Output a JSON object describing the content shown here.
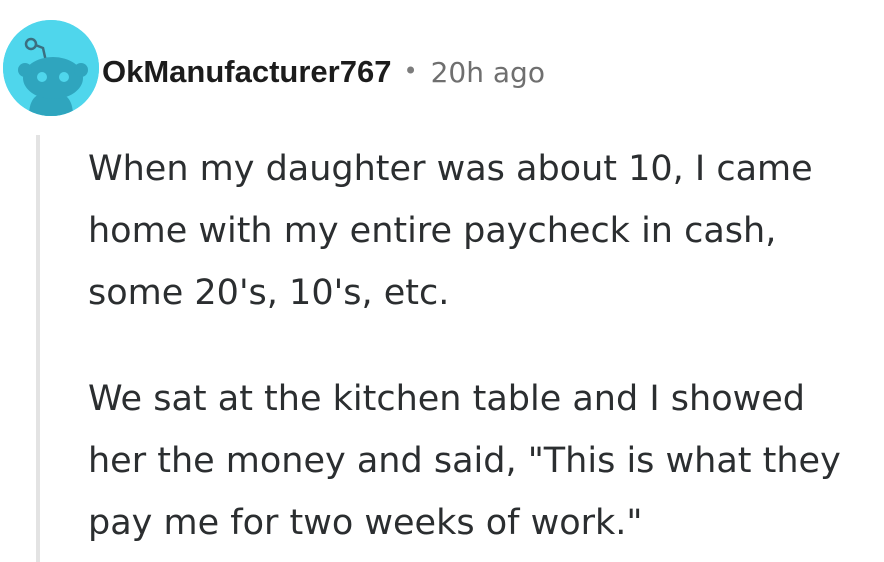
{
  "comment": {
    "avatar_icon": "reddit-snoo-avatar-icon",
    "avatar_bg_color": "#4fd6ec",
    "username": "OkManufacturer767",
    "separator": "•",
    "timestamp": "20h ago",
    "paragraphs": [
      {
        "lines": [
          "When my daughter was about 10, I came",
          "home with my entire paycheck in cash,",
          "some 20's, 10's, etc."
        ]
      },
      {
        "lines": [
          "We sat at the kitchen table and I showed",
          "her the money and said, \"This is what they",
          "pay me for two weeks of work.\""
        ]
      }
    ]
  }
}
